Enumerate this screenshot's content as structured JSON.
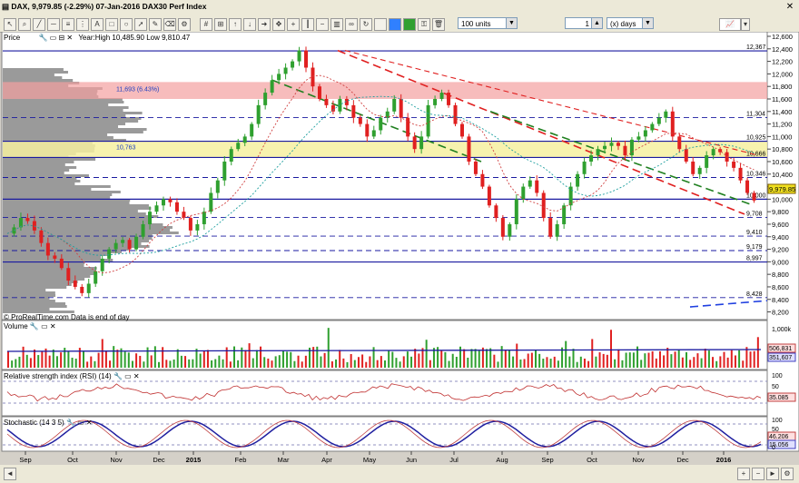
{
  "window": {
    "symbol": "DAX",
    "price": "9,979.85",
    "change": "(-2.29%)",
    "date": "07-Jan-2016",
    "instrument": "DAX30 Perf Index"
  },
  "toolbar": {
    "units_value": "100 units",
    "period_value": "1",
    "period_unit": "(x) days"
  },
  "price_panel": {
    "label": "Price",
    "year_range": "Year:High 10,485.90 Low 9,810.47",
    "credit": "© ProRealTime.com  Data is end of day",
    "current_price_tag": "9,979.85"
  },
  "volume_panel": {
    "label": "Volume",
    "tag1": "506,831",
    "tag2": "351,607"
  },
  "rsi_panel": {
    "label": "Relative strength index (RSI) (14)",
    "tag": "35.085"
  },
  "stoch_panel": {
    "label": "Stochastic (14 3 5)",
    "tag1": "46.206",
    "tag2": "15.056"
  },
  "colors": {
    "up": "#2fa02f",
    "down": "#e02020",
    "blue_level": "#1a1aa0",
    "resistance_zone": "#f4a0a0",
    "support_zone": "#f6f0a0"
  },
  "chart_data": {
    "type": "candlestick",
    "x_labels": [
      "Sep",
      "Oct",
      "Nov",
      "Dec",
      "2015",
      "Feb",
      "Mar",
      "Apr",
      "May",
      "Jun",
      "Jul",
      "Aug",
      "Sep",
      "Oct",
      "Nov",
      "Dec",
      "2016"
    ],
    "y_ticks": [
      8200,
      8400,
      8600,
      8800,
      9000,
      9200,
      9400,
      9600,
      9800,
      10000,
      10200,
      10400,
      10600,
      10800,
      11000,
      11200,
      11400,
      11600,
      11800,
      12000,
      12200,
      12400,
      12600
    ],
    "ylim": [
      8150,
      12600
    ],
    "levels": [
      {
        "value": 12367,
        "label": "12,367",
        "style": "solid"
      },
      {
        "value": 11693,
        "label": "11,693 (6.43%)",
        "style": "zone"
      },
      {
        "value": 11304,
        "label": "11,304",
        "style": "dashed"
      },
      {
        "value": 10925,
        "label": "10,925",
        "style": "solid"
      },
      {
        "value": 10763,
        "label": "10,763",
        "style": "zone"
      },
      {
        "value": 10666,
        "label": "10,666",
        "style": "solid"
      },
      {
        "value": 10346,
        "label": "10,346",
        "style": "dashed"
      },
      {
        "value": 10000,
        "label": "10,000",
        "style": "solid"
      },
      {
        "value": 9708,
        "label": "9,708",
        "style": "dashed"
      },
      {
        "value": 9410,
        "label": "9,410",
        "style": "dashed"
      },
      {
        "value": 9179,
        "label": "9,179",
        "style": "dashed"
      },
      {
        "value": 8997,
        "label": "8,997",
        "style": "solid"
      },
      {
        "value": 8428,
        "label": "8,428",
        "style": "dashed"
      }
    ],
    "close_path": [
      9450,
      9550,
      9700,
      9650,
      9500,
      9300,
      9100,
      9050,
      8900,
      8700,
      8600,
      8500,
      8650,
      8850,
      9050,
      9200,
      9300,
      9350,
      9200,
      9400,
      9600,
      9800,
      9900,
      10000,
      9950,
      9800,
      9700,
      9500,
      9600,
      9800,
      10100,
      10300,
      10600,
      10800,
      10900,
      11000,
      11200,
      11500,
      11700,
      11900,
      12000,
      12100,
      12200,
      12374,
      12100,
      11800,
      11600,
      11500,
      11400,
      11600,
      11500,
      11300,
      11200,
      11000,
      11100,
      11300,
      11400,
      11600,
      11300,
      11000,
      10800,
      11000,
      11500,
      11600,
      11700,
      11500,
      11200,
      11000,
      10600,
      10400,
      10200,
      9900,
      9700,
      9400,
      9600,
      10000,
      10200,
      10300,
      10100,
      9700,
      9400,
      9600,
      9900,
      10200,
      10400,
      10600,
      10700,
      10800,
      10850,
      10900,
      10850,
      10700,
      10950,
      11000,
      11100,
      11200,
      11300,
      11400,
      11000,
      10800,
      10600,
      10400,
      10500,
      10700,
      10800,
      10750,
      10600,
      10500,
      10300,
      10100,
      9979
    ]
  }
}
